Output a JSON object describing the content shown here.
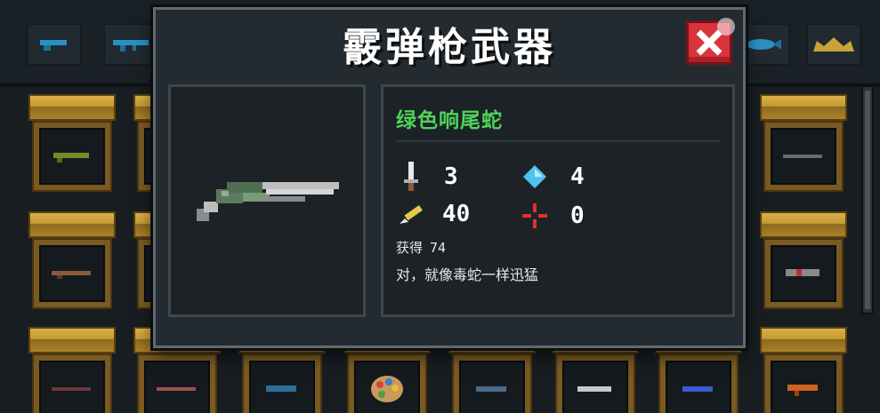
{
  "modal": {
    "title": "霰弹枪武器",
    "weapon": {
      "name": "绿色响尾蛇",
      "name_color": "#4fd35a",
      "stats": {
        "attack": "3",
        "energy": "4",
        "critical": "40",
        "spread": "0"
      },
      "obtain_label": "获得",
      "obtain_count": "74",
      "description": "对，就像毒蛇一样迅猛"
    },
    "icons": {
      "close": "close-x-icon",
      "attack": "sword-icon",
      "energy": "diamond-icon",
      "critical": "pencil-icon",
      "spread": "crosshair-icon"
    }
  },
  "colors": {
    "close_button": "#d9343c",
    "shelf_gold": "#c79a33",
    "panel_bg": "#1c2226"
  },
  "tabs": [
    {
      "icon": "pistol-icon"
    },
    {
      "icon": "rifle-icon"
    },
    {
      "icon": "fish-gun-icon"
    },
    {
      "icon": "crown-icon"
    }
  ]
}
